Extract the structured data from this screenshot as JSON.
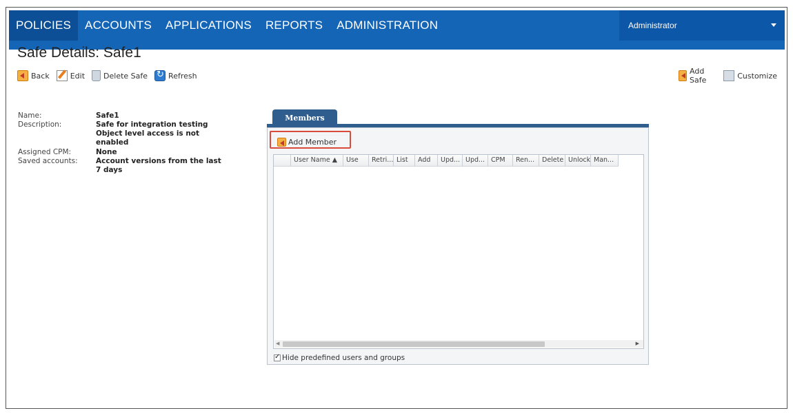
{
  "nav": {
    "items": [
      {
        "label": "POLICIES",
        "active": true
      },
      {
        "label": "ACCOUNTS",
        "active": false
      },
      {
        "label": "APPLICATIONS",
        "active": false
      },
      {
        "label": "REPORTS",
        "active": false
      },
      {
        "label": "ADMINISTRATION",
        "active": false
      }
    ],
    "user": "Administrator"
  },
  "page": {
    "title": "Safe Details: Safe1"
  },
  "toolbar": {
    "back": "Back",
    "edit": "Edit",
    "delete": "Delete Safe",
    "refresh": "Refresh",
    "add_safe": "Add Safe",
    "customize": "Customize"
  },
  "details": {
    "name_label": "Name:",
    "name_value": "Safe1",
    "description_label": "Description:",
    "description_value": "Safe for integration testing",
    "object_access": "Object level access is not enabled",
    "cpm_label": "Assigned CPM:",
    "cpm_value": "None",
    "saved_label": "Saved accounts:",
    "saved_value": "Account versions from the last 7 days"
  },
  "members": {
    "tab_label": "Members",
    "add_member": "Add Member",
    "columns": [
      "",
      "User Name ▲",
      "Use",
      "Retri...",
      "List",
      "Add",
      "Upd...",
      "Upd...",
      "CPM",
      "Ren...",
      "Delete",
      "Unlock",
      "Man..."
    ],
    "hide_predefined": "Hide predefined users and groups",
    "hide_checked": true
  },
  "colors": {
    "nav_bg": "#1565b7",
    "nav_active": "#0d4f96",
    "tab_bg": "#2f5e8e",
    "highlight": "#d94a3a"
  }
}
